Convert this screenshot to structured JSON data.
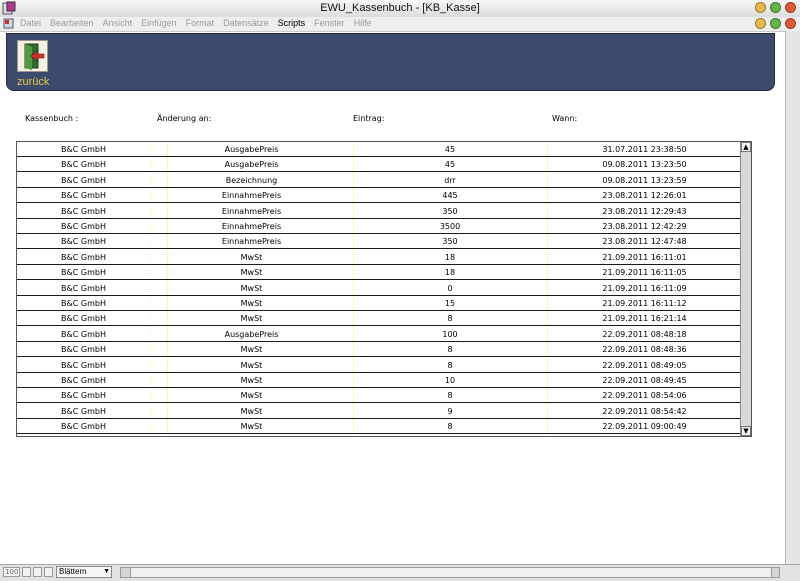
{
  "window": {
    "title": "EWU_Kassenbuch - [KB_Kasse]",
    "buttons": {
      "close": "#e05a3b",
      "minimize": "#e8b84a",
      "maximize": "#62b54a"
    }
  },
  "menu": {
    "items": [
      "Datei",
      "Bearbeiten",
      "Ansicht",
      "Einfügen",
      "Format",
      "Datensätze",
      "Scripts",
      "Fenster",
      "Hilfe"
    ],
    "active": "Scripts"
  },
  "header": {
    "background": "#3c4a6c",
    "back_label": "zurück",
    "back_icon": "door-exit-icon"
  },
  "columns": {
    "kassenbuch": "Kassenbuch :",
    "aenderung": "Änderung an:",
    "eintrag": "Eintrag:",
    "wann": "Wann:"
  },
  "rows": [
    {
      "kassenbuch": "B&C GmbH",
      "aenderung": "AusgabePreis",
      "eintrag": "45",
      "wann": "31.07.2011 23:38:50"
    },
    {
      "kassenbuch": "B&C GmbH",
      "aenderung": "AusgabePreis",
      "eintrag": "45",
      "wann": "09.08.2011 13:23:50"
    },
    {
      "kassenbuch": "B&C GmbH",
      "aenderung": "Bezeichnung",
      "eintrag": "drr",
      "wann": "09.08.2011 13:23:59"
    },
    {
      "kassenbuch": "B&C GmbH",
      "aenderung": "EinnahmePreis",
      "eintrag": "445",
      "wann": "23.08.2011 12:26:01"
    },
    {
      "kassenbuch": "B&C GmbH",
      "aenderung": "EinnahmePreis",
      "eintrag": "350",
      "wann": "23.08.2011 12:29:43"
    },
    {
      "kassenbuch": "B&C GmbH",
      "aenderung": "EinnahmePreis",
      "eintrag": "3500",
      "wann": "23.08.2011 12:42:29"
    },
    {
      "kassenbuch": "B&C GmbH",
      "aenderung": "EinnahmePreis",
      "eintrag": "350",
      "wann": "23.08.2011 12:47:48"
    },
    {
      "kassenbuch": "B&C GmbH",
      "aenderung": "MwSt",
      "eintrag": "18",
      "wann": "21.09.2011 16:11:01"
    },
    {
      "kassenbuch": "B&C GmbH",
      "aenderung": "MwSt",
      "eintrag": "18",
      "wann": "21.09.2011 16:11:05"
    },
    {
      "kassenbuch": "B&C GmbH",
      "aenderung": "MwSt",
      "eintrag": "0",
      "wann": "21.09.2011 16:11:09"
    },
    {
      "kassenbuch": "B&C GmbH",
      "aenderung": "MwSt",
      "eintrag": "15",
      "wann": "21.09.2011 16:11:12"
    },
    {
      "kassenbuch": "B&C GmbH",
      "aenderung": "MwSt",
      "eintrag": "8",
      "wann": "21.09.2011 16:21:14"
    },
    {
      "kassenbuch": "B&C GmbH",
      "aenderung": "AusgabePreis",
      "eintrag": "100",
      "wann": "22.09.2011 08:48:18"
    },
    {
      "kassenbuch": "B&C GmbH",
      "aenderung": "MwSt",
      "eintrag": "8",
      "wann": "22.09.2011 08:48:36"
    },
    {
      "kassenbuch": "B&C GmbH",
      "aenderung": "MwSt",
      "eintrag": "8",
      "wann": "22.09.2011 08:49:05"
    },
    {
      "kassenbuch": "B&C GmbH",
      "aenderung": "MwSt",
      "eintrag": "10",
      "wann": "22.09.2011 08:49:45"
    },
    {
      "kassenbuch": "B&C GmbH",
      "aenderung": "MwSt",
      "eintrag": "8",
      "wann": "22.09.2011 08:54:06"
    },
    {
      "kassenbuch": "B&C GmbH",
      "aenderung": "MwSt",
      "eintrag": "9",
      "wann": "22.09.2011 08:54:42"
    },
    {
      "kassenbuch": "B&C GmbH",
      "aenderung": "MwSt",
      "eintrag": "8",
      "wann": "22.09.2011 09:00:49"
    }
  ],
  "statusbar": {
    "zoom": "100",
    "mode": "Blättern"
  }
}
